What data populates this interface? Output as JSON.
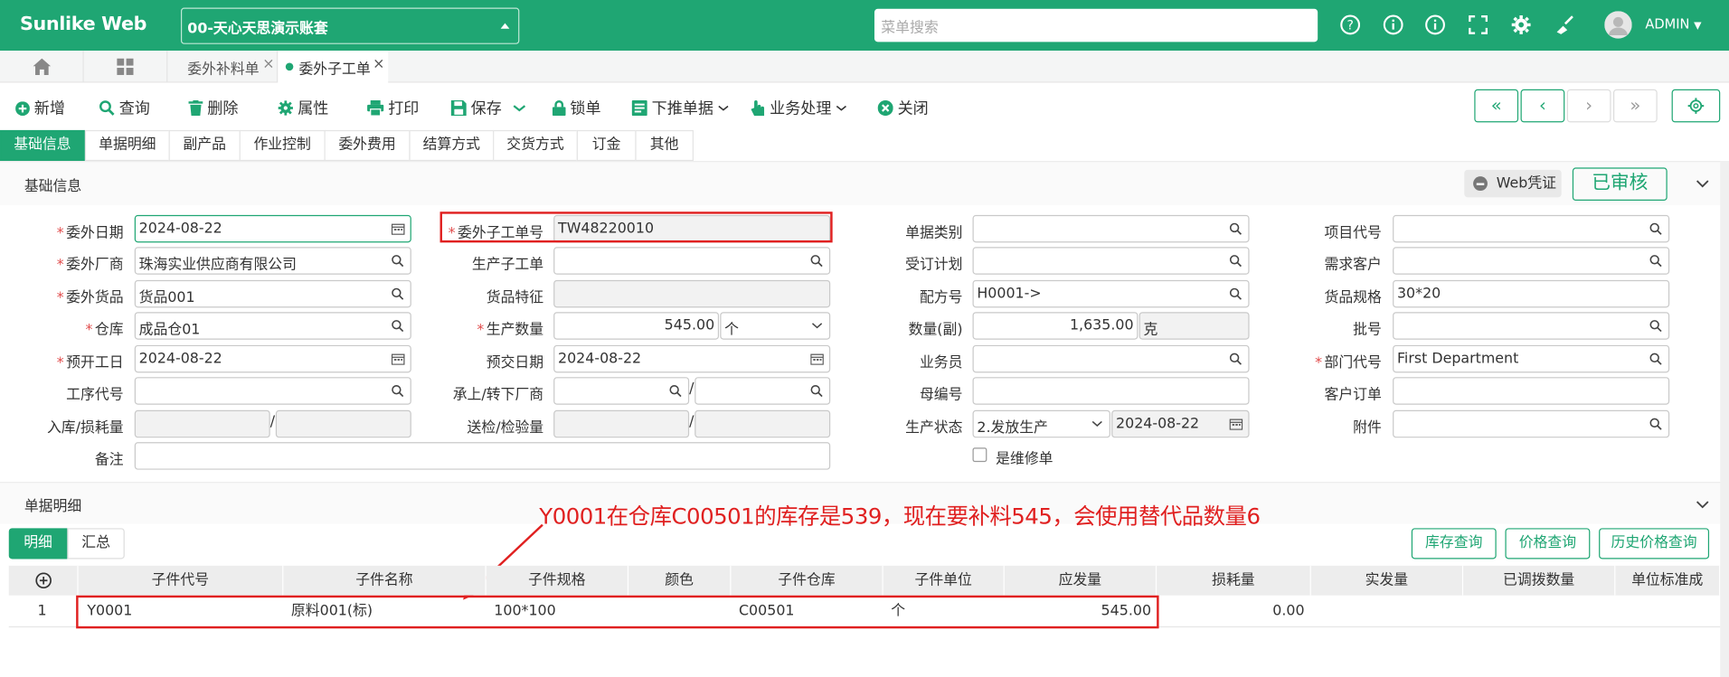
{
  "app": {
    "title": "Sunlike Web",
    "account": "00-天心天思演示账套",
    "search_placeholder": "菜单搜索",
    "user": "ADMIN"
  },
  "doc_tabs": [
    {
      "label": "委外补料单"
    },
    {
      "label": "委外子工单"
    }
  ],
  "toolbar": {
    "new": "新增",
    "query": "查询",
    "delete": "删除",
    "props": "属性",
    "print": "打印",
    "save": "保存",
    "lock": "锁单",
    "push": "下推单据",
    "biz": "业务处理",
    "close": "关闭"
  },
  "sub_tabs": [
    "基础信息",
    "单据明细",
    "副产品",
    "作业控制",
    "委外费用",
    "结算方式",
    "交货方式",
    "订金",
    "其他"
  ],
  "section_basic": {
    "title": "基础信息",
    "voucher": "Web凭证",
    "status": "已审核"
  },
  "form": {
    "f1": {
      "label": "委外日期",
      "value": "2024-08-22"
    },
    "f2": {
      "label": "委外厂商",
      "value": "珠海实业供应商有限公司"
    },
    "f3": {
      "label": "委外货品",
      "value": "货品001"
    },
    "f4": {
      "label": "仓库",
      "value": "成品仓01"
    },
    "f5": {
      "label": "预开工日",
      "value": "2024-08-22"
    },
    "f6": {
      "label": "工序代号",
      "value": ""
    },
    "f7": {
      "label": "入库/损耗量",
      "value": ""
    },
    "f8": {
      "label": "备注",
      "value": ""
    },
    "g1": {
      "label": "委外子工单号",
      "value": "TW48220010"
    },
    "g2": {
      "label": "生产子工单",
      "value": ""
    },
    "g3": {
      "label": "货品特征",
      "value": ""
    },
    "g4": {
      "label": "生产数量",
      "value": "545.00",
      "unit": "个"
    },
    "g5": {
      "label": "预交日期",
      "value": "2024-08-22"
    },
    "g6": {
      "label": "承上/转下厂商",
      "value": ""
    },
    "g7": {
      "label": "送检/检验量",
      "value": ""
    },
    "h1": {
      "label": "单据类别",
      "value": ""
    },
    "h2": {
      "label": "受订计划",
      "value": ""
    },
    "h3": {
      "label": "配方号",
      "value": "H0001->"
    },
    "h4": {
      "label": "数量(副)",
      "value": "1,635.00",
      "unit": "克"
    },
    "h5": {
      "label": "业务员",
      "value": ""
    },
    "h6": {
      "label": "母编号",
      "value": ""
    },
    "h7": {
      "label": "生产状态",
      "value": "2.发放生产",
      "date": "2024-08-22"
    },
    "h8": {
      "label": "是维修单"
    },
    "i1": {
      "label": "项目代号",
      "value": ""
    },
    "i2": {
      "label": "需求客户",
      "value": ""
    },
    "i3": {
      "label": "货品规格",
      "value": "30*20"
    },
    "i4": {
      "label": "批号",
      "value": ""
    },
    "i5": {
      "label": "部门代号",
      "value": "First Department"
    },
    "i6": {
      "label": "客户订单",
      "value": ""
    },
    "i7": {
      "label": "附件",
      "value": ""
    }
  },
  "detail": {
    "title": "单据明细",
    "tabs": [
      "明细",
      "汇总"
    ],
    "buttons": [
      "库存查询",
      "价格查询",
      "历史价格查询"
    ],
    "annotation": "Y0001在仓库C00501的库存是539，现在要补料545，会使用替代品数量6",
    "columns": [
      "子件代号",
      "子件名称",
      "子件规格",
      "颜色",
      "子件仓库",
      "子件单位",
      "应发量",
      "损耗量",
      "实发量",
      "已调拨数量",
      "单位标准成"
    ],
    "rows": [
      {
        "no": "1",
        "code": "Y0001",
        "name": "原料001(标)",
        "spec": "100*100",
        "color": "",
        "wh": "C00501",
        "unit": "个",
        "qty": "545.00",
        "loss": "0.00",
        "actual": "",
        "moved": "",
        "cost": ""
      }
    ]
  },
  "colors": {
    "brand": "#1fa673",
    "required": "#e14b4b",
    "annotation": "#e02020"
  }
}
